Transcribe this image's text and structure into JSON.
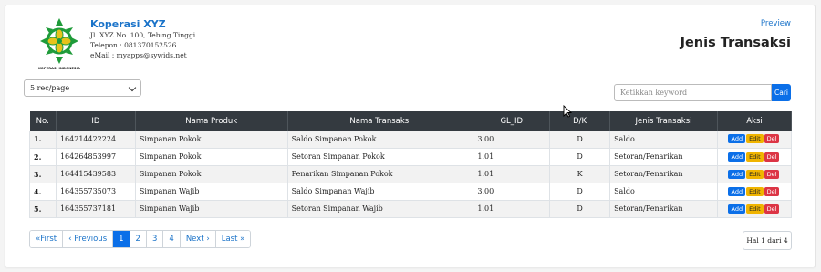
{
  "company": {
    "name": "Koperasi XYZ",
    "address": "Jl. XYZ No. 100, Tebing Tinggi",
    "phone": "Telepon : 081370152526",
    "email": "eMail : myapps@sywids.net",
    "logo_caption": "KOPERASI INDONESIA"
  },
  "header": {
    "preview_label": "Preview",
    "title": "Jenis Transaksi"
  },
  "controls": {
    "per_page": "5 rec/page",
    "search_placeholder": "Ketikkan keyword",
    "search_button": "Cari"
  },
  "table": {
    "columns": [
      "No.",
      "ID",
      "Nama Produk",
      "Nama Transaksi",
      "GL_ID",
      "D/K",
      "Jenis Transaksi",
      "Aksi"
    ],
    "rows": [
      [
        "1.",
        "164214422224",
        "Simpanan Pokok",
        "Saldo Simpanan Pokok",
        "3.00",
        "D",
        "Saldo"
      ],
      [
        "2.",
        "164264853997",
        "Simpanan Pokok",
        "Setoran Simpanan Pokok",
        "1.01",
        "D",
        "Setoran/Penarikan"
      ],
      [
        "3.",
        "164415439583",
        "Simpanan Pokok",
        "Penarikan Simpanan Pokok",
        "1.01",
        "K",
        "Setoran/Penarikan"
      ],
      [
        "4.",
        "164355735073",
        "Simpanan Wajib",
        "Saldo Simpanan Wajib",
        "3.00",
        "D",
        "Saldo"
      ],
      [
        "5.",
        "164355737181",
        "Simpanan Wajib",
        "Setoran Simpanan Wajib",
        "1.01",
        "D",
        "Setoran/Penarikan"
      ]
    ],
    "actions": {
      "add": "Add",
      "edit": "Edit",
      "del": "Del"
    }
  },
  "pagination": {
    "first": "«First",
    "previous": "‹ Previous",
    "pages": [
      "1",
      "2",
      "3",
      "4"
    ],
    "next": "Next ›",
    "last": "Last »",
    "info": "Hal 1 dari 4"
  },
  "colors": {
    "accent": "#0b6fe8",
    "header_bg": "#343a40",
    "edit": "#f0b400",
    "delete": "#dc3545",
    "logo_green": "#1f9b3a"
  }
}
